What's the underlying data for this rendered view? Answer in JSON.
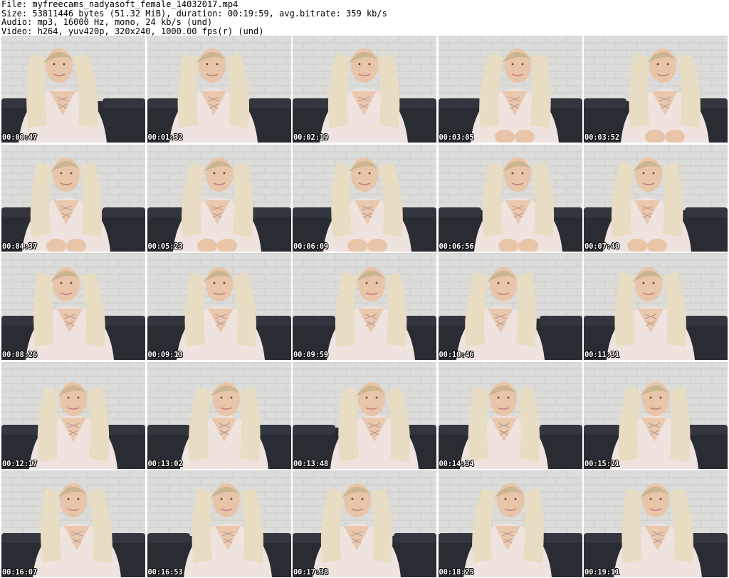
{
  "header": {
    "file_line": "File: myfreecams_nadyasoft_female_14032017.mp4",
    "size_line": "Size: 53811446 bytes (51.32 MiB), duration: 00:19:59, avg.bitrate: 359 kb/s",
    "audio_line": "Audio: mp3, 16000 Hz, mono, 24 kb/s (und)",
    "video_line": "Video: h264, yuv420p, 320x240, 1000.00 fps(r) (und)"
  },
  "frames": [
    {
      "timestamp": "00:00:47"
    },
    {
      "timestamp": "00:01:32"
    },
    {
      "timestamp": "00:02:19"
    },
    {
      "timestamp": "00:03:05"
    },
    {
      "timestamp": "00:03:52"
    },
    {
      "timestamp": "00:04:37"
    },
    {
      "timestamp": "00:05:23"
    },
    {
      "timestamp": "00:06:09"
    },
    {
      "timestamp": "00:06:56"
    },
    {
      "timestamp": "00:07:40"
    },
    {
      "timestamp": "00:08:26"
    },
    {
      "timestamp": "00:09:13"
    },
    {
      "timestamp": "00:09:59"
    },
    {
      "timestamp": "00:10:46"
    },
    {
      "timestamp": "00:11:31"
    },
    {
      "timestamp": "00:12:17"
    },
    {
      "timestamp": "00:13:02"
    },
    {
      "timestamp": "00:13:48"
    },
    {
      "timestamp": "00:14:34"
    },
    {
      "timestamp": "00:15:21"
    },
    {
      "timestamp": "00:16:07"
    },
    {
      "timestamp": "00:16:53"
    },
    {
      "timestamp": "00:17:38"
    },
    {
      "timestamp": "00:18:25"
    },
    {
      "timestamp": "00:19:11"
    }
  ],
  "colors": {
    "wall": "#dcdcda",
    "brick_line": "#c8c8c6",
    "sofa": "#2a2c33",
    "hair": "#e8dcc2",
    "hair_shadow": "#c9b58f",
    "skin": "#e8c4a8",
    "top": "#efe3df",
    "timestamp_text": "#ffffff"
  }
}
